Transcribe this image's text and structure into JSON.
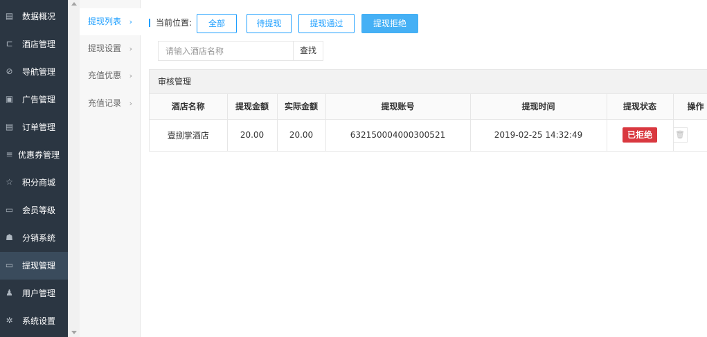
{
  "sidebar": {
    "items": [
      {
        "label": "数据概况",
        "icon": "newspaper-icon",
        "glyph": "▤"
      },
      {
        "label": "酒店管理",
        "icon": "cart-icon",
        "glyph": "⊏"
      },
      {
        "label": "导航管理",
        "icon": "compass-icon",
        "glyph": "⊘"
      },
      {
        "label": "广告管理",
        "icon": "gift-icon",
        "glyph": "▣"
      },
      {
        "label": "订单管理",
        "icon": "list-icon",
        "glyph": "▤"
      },
      {
        "label": "优惠券管理",
        "icon": "bars-icon",
        "glyph": "≡"
      },
      {
        "label": "积分商城",
        "icon": "star-icon",
        "glyph": "☆"
      },
      {
        "label": "会员等级",
        "icon": "card-icon",
        "glyph": "▭"
      },
      {
        "label": "分销系统",
        "icon": "users-icon",
        "glyph": "☗"
      },
      {
        "label": "提现管理",
        "icon": "money-icon",
        "glyph": "▭",
        "active": true
      },
      {
        "label": "用户管理",
        "icon": "user-icon",
        "glyph": "♟"
      },
      {
        "label": "系统设置",
        "icon": "gear-icon",
        "glyph": "✲"
      }
    ]
  },
  "submenu": {
    "items": [
      {
        "label": "提现列表",
        "active": true
      },
      {
        "label": "提现设置"
      },
      {
        "label": "充值优惠"
      },
      {
        "label": "充值记录"
      }
    ]
  },
  "breadcrumb": {
    "label": "当前位置:"
  },
  "filters": [
    {
      "label": "全部"
    },
    {
      "label": "待提现"
    },
    {
      "label": "提现通过"
    },
    {
      "label": "提现拒绝",
      "active": true
    }
  ],
  "search": {
    "placeholder": "请输入酒店名称",
    "button": "查找"
  },
  "panel": {
    "title": "审核管理"
  },
  "table": {
    "columns": [
      "酒店名称",
      "提现金额",
      "实际金额",
      "提现账号",
      "提现时间",
      "提现状态",
      "操作"
    ],
    "rows": [
      {
        "hotel": "壹捌掌酒店",
        "amount": "20.00",
        "actual": "20.00",
        "account": "632150004000300521",
        "time": "2019-02-25 14:32:49",
        "status": "已拒绝"
      }
    ]
  },
  "colors": {
    "accent": "#1e9fff",
    "sidebar_bg": "#2b3642",
    "status_rejected": "#d9383f"
  }
}
